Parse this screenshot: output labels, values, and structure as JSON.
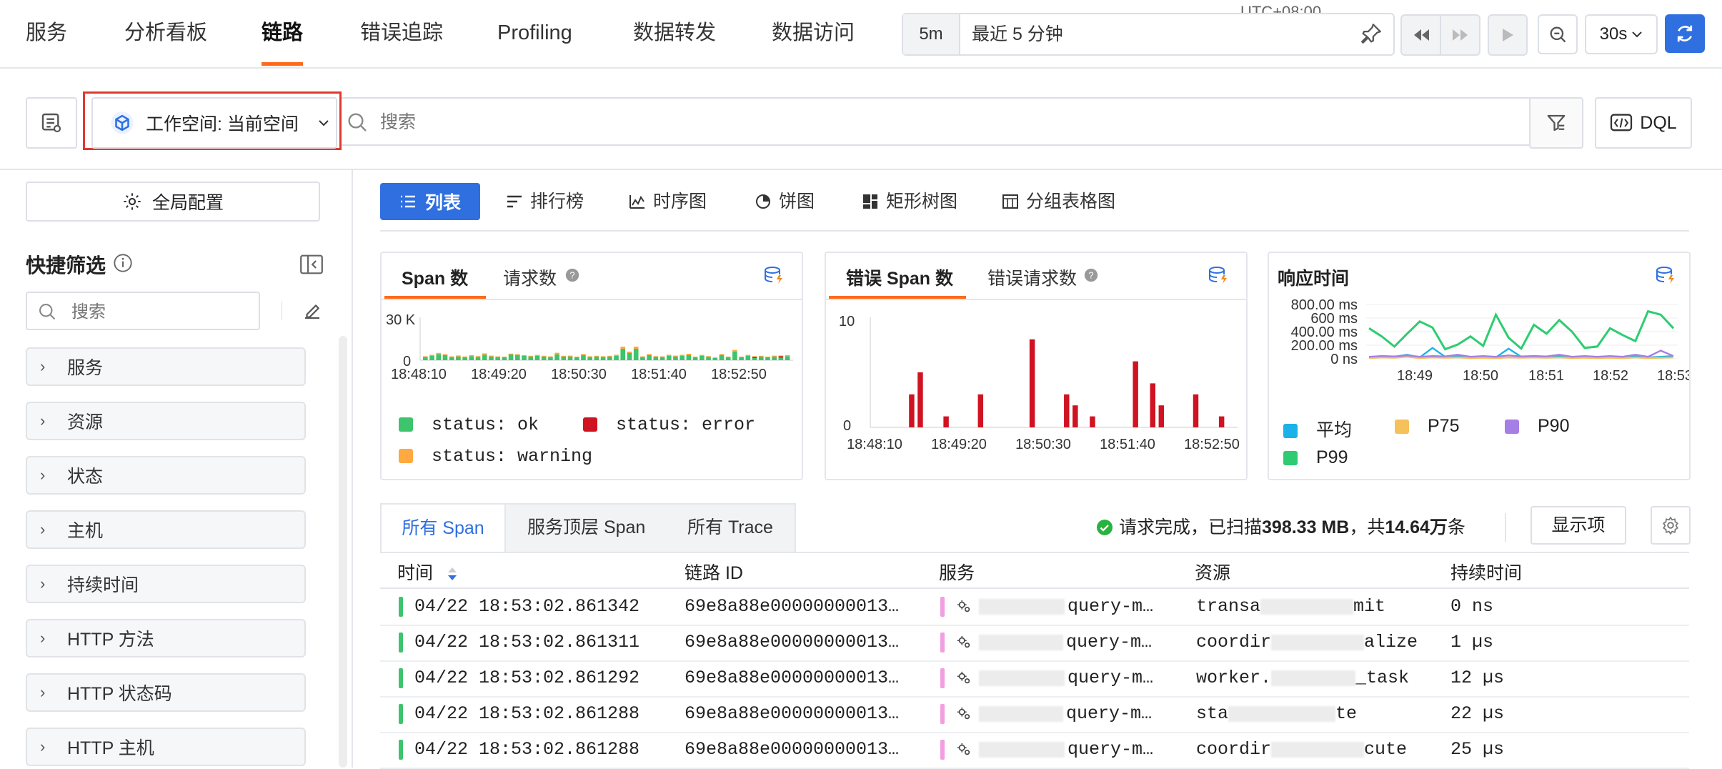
{
  "nav": {
    "tabs": [
      "服务",
      "分析看板",
      "链路",
      "错误追踪",
      "Profiling",
      "数据转发",
      "数据访问"
    ],
    "active_index": 2
  },
  "time": {
    "timezone": "UTC+08:00",
    "range_short": "5m",
    "range_label": "最近 5 分钟",
    "refresh_interval": "30s"
  },
  "search_row": {
    "workspace_label": "工作空间: 当前空间",
    "search_placeholder": "搜索",
    "dql_label": "DQL"
  },
  "sidebar": {
    "global_config": "全局配置",
    "quick_filter_title": "快捷筛选",
    "search_placeholder": "搜索",
    "facets": [
      "服务",
      "资源",
      "状态",
      "主机",
      "持续时间",
      "HTTP 方法",
      "HTTP 状态码",
      "HTTP 主机"
    ]
  },
  "view_tabs": {
    "items": [
      "列表",
      "排行榜",
      "时序图",
      "饼图",
      "矩形树图",
      "分组表格图"
    ],
    "active_index": 0
  },
  "cards": {
    "span": {
      "tabs": [
        "Span 数",
        "请求数"
      ],
      "legend": [
        "status: ok",
        "status: error",
        "status: warning"
      ]
    },
    "error": {
      "tabs": [
        "错误 Span 数",
        "错误请求数"
      ]
    },
    "resp": {
      "title": "响应时间",
      "legend": [
        "平均",
        "P75",
        "P90",
        "P99"
      ]
    }
  },
  "colors": {
    "ok": "#3ec46d",
    "error": "#cf1322",
    "warning": "#ffa940",
    "avg": "#1ab2e8",
    "p75": "#f6c05a",
    "p90": "#a57ee6",
    "p99": "#2ecc71",
    "accent": "#2f6fe0",
    "nav_active": "#ff6a1a"
  },
  "chart_data": [
    {
      "type": "bar",
      "title": "Span 数",
      "x_ticks": [
        "18:48:10",
        "18:49:20",
        "18:50:30",
        "18:51:40",
        "18:52:50"
      ],
      "y_ticks": [
        "30 K",
        "0"
      ],
      "ylim": [
        0,
        30000
      ],
      "series": [
        {
          "name": "status: ok",
          "values": [
            2200,
            3000,
            4200,
            3500,
            2200,
            2500,
            2000,
            2800,
            2200,
            3800,
            2500,
            2200,
            2000,
            4000,
            3500,
            3000,
            2500,
            3000,
            2500,
            2200,
            4000,
            2500,
            2500,
            2000,
            3500,
            2200,
            2500,
            2300,
            2500,
            3000,
            8000,
            5000,
            8000,
            2200,
            3500,
            2300,
            2200,
            3000,
            2500,
            3000,
            3500,
            2000,
            3000,
            2300,
            1500,
            3500,
            2000,
            6000,
            2000,
            3000,
            1500,
            2500,
            2000,
            2500,
            1800,
            2800
          ]
        },
        {
          "name": "status: error",
          "values": [
            0,
            0,
            0,
            0,
            0,
            0,
            0,
            0,
            0,
            0,
            0,
            0,
            0,
            0,
            0,
            0,
            0,
            0,
            0,
            0,
            0,
            0,
            0,
            0,
            0,
            0,
            0,
            0,
            0,
            0,
            0,
            0,
            0,
            0,
            0,
            0,
            0,
            0,
            0,
            0,
            0,
            0,
            0,
            0,
            0,
            0,
            0,
            0,
            0,
            0,
            800,
            0,
            0,
            0,
            1000,
            0
          ]
        },
        {
          "name": "status: warning",
          "values": [
            600,
            800,
            900,
            700,
            500,
            800,
            600,
            700,
            700,
            1000,
            700,
            500,
            500,
            600,
            700,
            500,
            600,
            700,
            600,
            500,
            1200,
            600,
            700,
            500,
            800,
            600,
            600,
            500,
            600,
            800,
            1500,
            1000,
            1500,
            500,
            800,
            600,
            500,
            800,
            700,
            800,
            1000,
            500,
            700,
            600,
            400,
            800,
            500,
            1200,
            500,
            700,
            500,
            600,
            500,
            700,
            500,
            700
          ]
        }
      ]
    },
    {
      "type": "bar",
      "title": "错误 Span 数",
      "x_ticks": [
        "18:48:10",
        "18:49:20",
        "18:50:30",
        "18:51:40",
        "18:52:50"
      ],
      "y_ticks": [
        "10",
        "0"
      ],
      "ylim": [
        0,
        10
      ],
      "series": [
        {
          "name": "status: error",
          "values": [
            0,
            0,
            0,
            0,
            3,
            5,
            0,
            0,
            1,
            0,
            0,
            0,
            3,
            0,
            0,
            0,
            0,
            0,
            8,
            0,
            0,
            0,
            3,
            2,
            0,
            1,
            0,
            0,
            0,
            0,
            6,
            0,
            4,
            2,
            0,
            0,
            0,
            3,
            0,
            0,
            1,
            0
          ]
        }
      ]
    },
    {
      "type": "line",
      "title": "响应时间",
      "x_ticks": [
        "18:49",
        "18:50",
        "18:51",
        "18:52",
        "18:53"
      ],
      "y_ticks": [
        "800.00 ms",
        "600 ms",
        "400.00 ms",
        "200.00 ms",
        "0 ns"
      ],
      "ylim": [
        0,
        800
      ],
      "series": [
        {
          "name": "平均",
          "values": [
            20,
            40,
            30,
            60,
            20,
            160,
            30,
            40,
            20,
            30,
            20,
            150,
            30,
            40,
            30,
            40,
            20,
            30,
            20,
            30,
            20,
            40,
            20,
            30,
            40
          ]
        },
        {
          "name": "P75",
          "values": [
            10,
            20,
            15,
            30,
            10,
            20,
            15,
            20,
            10,
            15,
            10,
            20,
            15,
            20,
            15,
            20,
            10,
            15,
            10,
            15,
            10,
            20,
            10,
            15,
            20
          ]
        },
        {
          "name": "P90",
          "values": [
            30,
            40,
            35,
            50,
            30,
            40,
            35,
            60,
            30,
            40,
            30,
            50,
            35,
            40,
            35,
            60,
            30,
            40,
            30,
            40,
            30,
            60,
            30,
            120,
            40
          ]
        },
        {
          "name": "P99",
          "values": [
            450,
            330,
            180,
            370,
            550,
            460,
            140,
            210,
            330,
            190,
            650,
            310,
            150,
            500,
            370,
            570,
            400,
            160,
            180,
            450,
            350,
            260,
            700,
            650,
            450
          ]
        }
      ]
    }
  ],
  "table": {
    "sub_tabs": [
      "所有 Span",
      "服务顶层 Span",
      "所有 Trace"
    ],
    "active_sub_tab": 0,
    "status_prefix": "请求完成，已扫描 ",
    "status_size": "398.33 MB",
    "status_mid": "，共 ",
    "status_count": "14.64万",
    "status_suffix": " 条",
    "display_button": "显示项",
    "columns": [
      "时间",
      "链路 ID",
      "服务",
      "资源",
      "持续时间"
    ],
    "rows": [
      {
        "time": "04/22 18:53:02.861342",
        "trace_id": "69e8a88e00000000013…",
        "service": "query-m…",
        "res_a": "transa",
        "res_b": "mit",
        "duration": "0 ns"
      },
      {
        "time": "04/22 18:53:02.861311",
        "trace_id": "69e8a88e00000000013…",
        "service": "query-m…",
        "res_a": "coordir",
        "res_b": "alize",
        "duration": "1 µs"
      },
      {
        "time": "04/22 18:53:02.861292",
        "trace_id": "69e8a88e00000000013…",
        "service": "query-m…",
        "res_a": "worker.",
        "res_b": "_task",
        "duration": "12 µs"
      },
      {
        "time": "04/22 18:53:02.861288",
        "trace_id": "69e8a88e00000000013…",
        "service": "query-m…",
        "res_a": "sta",
        "res_b": "te",
        "duration": "22 µs"
      },
      {
        "time": "04/22 18:53:02.861288",
        "trace_id": "69e8a88e00000000013…",
        "service": "query-m…",
        "res_a": "coordir",
        "res_b": "cute",
        "duration": "25 µs"
      }
    ]
  }
}
